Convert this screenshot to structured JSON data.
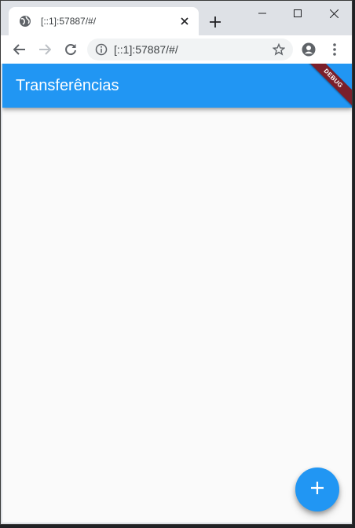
{
  "browser": {
    "tab": {
      "title": "[::1]:57887/#/",
      "favicon": "globe-icon"
    },
    "address": {
      "url": "[::1]:57887/#/"
    }
  },
  "app": {
    "title": "Transferências",
    "debug_banner": "DEBUG",
    "fab_icon": "plus-icon",
    "colors": {
      "primary": "#2196f3",
      "background": "#fafafa",
      "debug": "#7a1f2b"
    }
  }
}
